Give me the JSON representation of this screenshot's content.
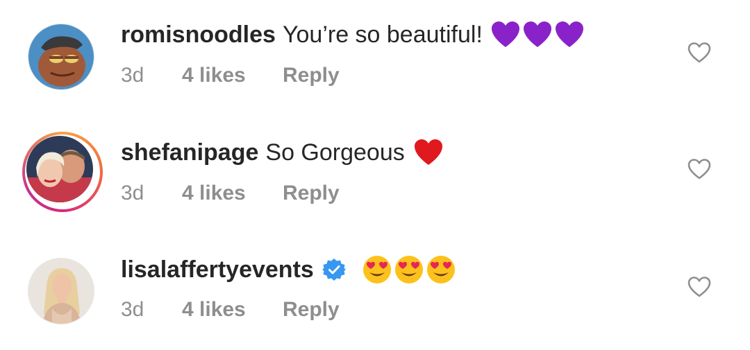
{
  "comments": [
    {
      "username": "romisnoodles",
      "text": "You’re so beautiful!",
      "emoji": [
        "purple-heart",
        "purple-heart",
        "purple-heart"
      ],
      "time": "3d",
      "likes": "4 likes",
      "reply": "Reply",
      "verified": false
    },
    {
      "username": "shefanipage",
      "text": "So Gorgeous",
      "emoji": [
        "red-heart"
      ],
      "time": "3d",
      "likes": "4 likes",
      "reply": "Reply",
      "verified": false
    },
    {
      "username": "lisalaffertyevents",
      "text": "",
      "emoji": [
        "heart-eyes-face",
        "heart-eyes-face",
        "heart-eyes-face"
      ],
      "time": "3d",
      "likes": "4 likes",
      "reply": "Reply",
      "verified": true
    }
  ],
  "colors": {
    "text": "#262626",
    "meta": "#8e8e8e",
    "purple_heart": "#8a22c9",
    "red_heart": "#e0191f",
    "verified": "#3897f0"
  }
}
